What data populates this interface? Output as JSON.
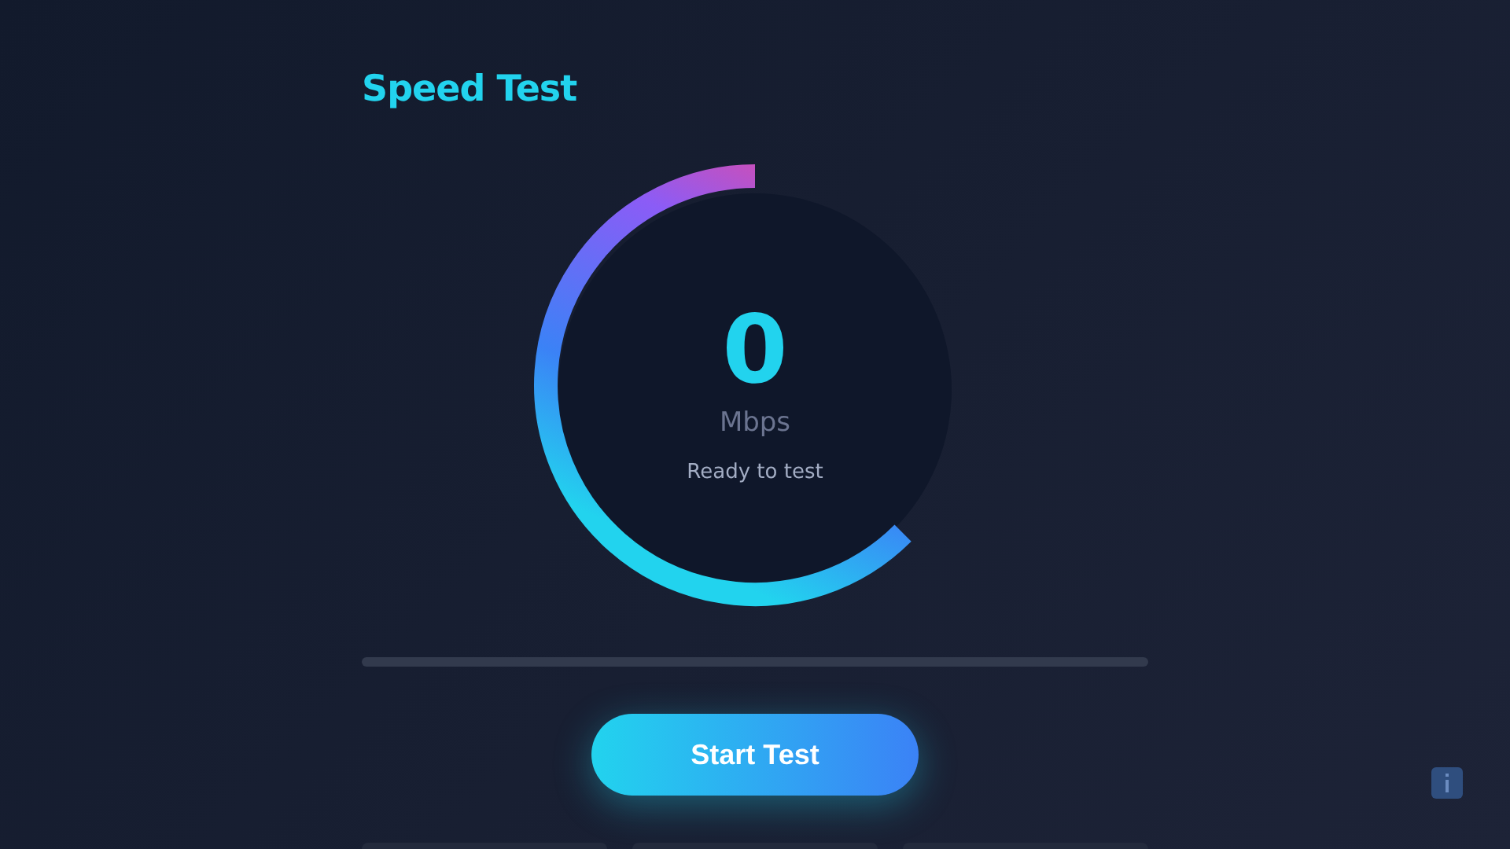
{
  "title": "Speed Test",
  "gauge": {
    "value": "0",
    "unit": "Mbps",
    "status": "Ready to test"
  },
  "progress": {
    "level": 0
  },
  "start_button": {
    "label": "Start Test"
  }
}
